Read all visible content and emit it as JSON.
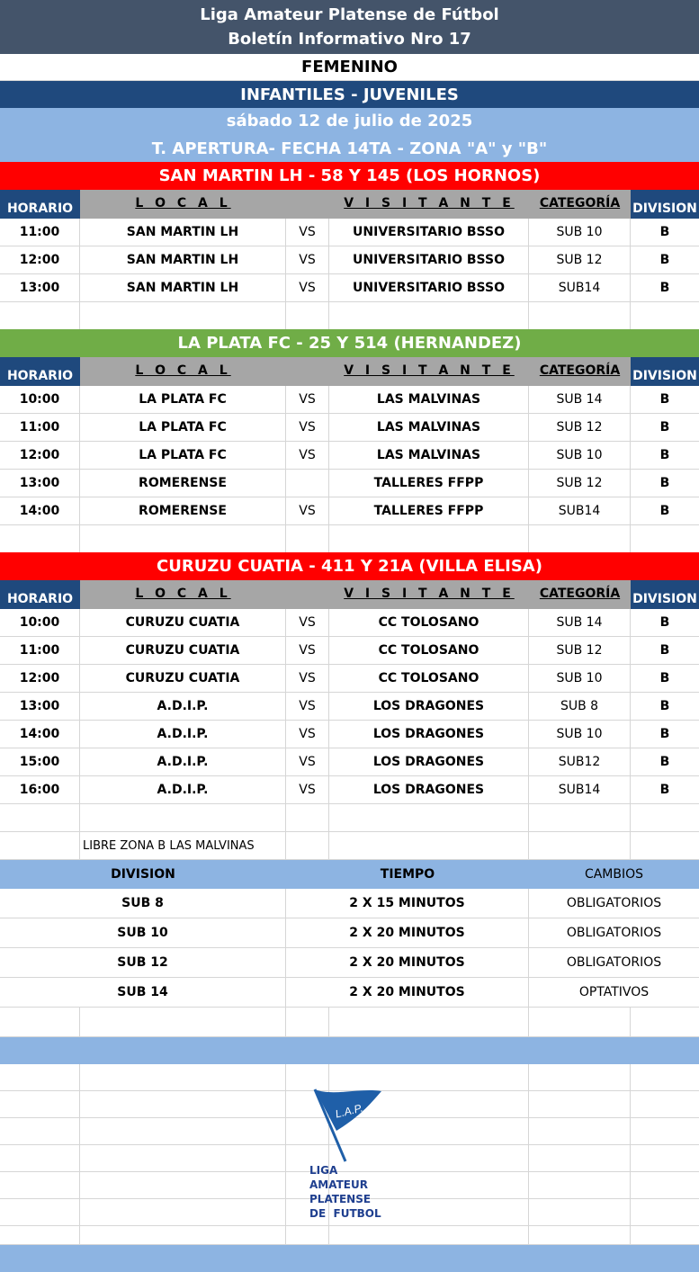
{
  "header": {
    "title_line1": "Liga Amateur Platense de Fútbol",
    "title_line2": "Boletín Informativo Nro 17",
    "branch": "FEMENINO",
    "categories": "INFANTILES - JUVENILES",
    "date": "sábado 12 de julio de 2025",
    "tournament": "T. APERTURA- FECHA 14TA - ZONA \"A\" y \"B\""
  },
  "columns": {
    "horario": "HORARIO",
    "local": "L O C A L",
    "visitante": "V I S I T A N T E",
    "categoria": "CATEGORÍA",
    "division": "DIVISION"
  },
  "venues": [
    {
      "name": "SAN MARTIN LH - 58 Y 145 (LOS HORNOS)",
      "color": "#ff0000",
      "matches": [
        {
          "time": "11:00",
          "local": "SAN MARTIN LH",
          "vs": "VS",
          "visitor": "UNIVERSITARIO BSSO",
          "category": "SUB 10",
          "division": "B"
        },
        {
          "time": "12:00",
          "local": "SAN MARTIN LH",
          "vs": "VS",
          "visitor": "UNIVERSITARIO BSSO",
          "category": "SUB 12",
          "division": "B"
        },
        {
          "time": "13:00",
          "local": "SAN MARTIN LH",
          "vs": "VS",
          "visitor": "UNIVERSITARIO BSSO",
          "category": "SUB14",
          "division": "B"
        }
      ]
    },
    {
      "name": "LA PLATA FC - 25 Y 514 (HERNANDEZ)",
      "color": "#70ad47",
      "matches": [
        {
          "time": "10:00",
          "local": "LA PLATA FC",
          "vs": "VS",
          "visitor": "LAS MALVINAS",
          "category": "SUB 14",
          "division": "B"
        },
        {
          "time": "11:00",
          "local": "LA PLATA FC",
          "vs": "VS",
          "visitor": "LAS MALVINAS",
          "category": "SUB 12",
          "division": "B"
        },
        {
          "time": "12:00",
          "local": "LA PLATA FC",
          "vs": "VS",
          "visitor": "LAS MALVINAS",
          "category": "SUB 10",
          "division": "B"
        },
        {
          "time": "13:00",
          "local": "ROMERENSE",
          "vs": "",
          "visitor": "TALLERES FFPP",
          "category": "SUB 12",
          "division": "B"
        },
        {
          "time": "14:00",
          "local": "ROMERENSE",
          "vs": "VS",
          "visitor": "TALLERES FFPP",
          "category": "SUB14",
          "division": "B"
        }
      ]
    },
    {
      "name": "CURUZU CUATIA - 411 Y 21A (VILLA ELISA)",
      "color": "#ff0000",
      "matches": [
        {
          "time": "10:00",
          "local": "CURUZU CUATIA",
          "vs": "VS",
          "visitor": "CC TOLOSANO",
          "category": "SUB 14",
          "division": "B"
        },
        {
          "time": "11:00",
          "local": "CURUZU CUATIA",
          "vs": "VS",
          "visitor": "CC TOLOSANO",
          "category": "SUB 12",
          "division": "B"
        },
        {
          "time": "12:00",
          "local": "CURUZU CUATIA",
          "vs": "VS",
          "visitor": "CC TOLOSANO",
          "category": "SUB 10",
          "division": "B"
        },
        {
          "time": "13:00",
          "local": "A.D.I.P.",
          "vs": "VS",
          "visitor": "LOS DRAGONES",
          "category": "SUB 8",
          "division": "B"
        },
        {
          "time": "14:00",
          "local": "A.D.I.P.",
          "vs": "VS",
          "visitor": "LOS DRAGONES",
          "category": "SUB 10",
          "division": "B"
        },
        {
          "time": "15:00",
          "local": "A.D.I.P.",
          "vs": "VS",
          "visitor": "LOS DRAGONES",
          "category": "SUB12",
          "division": "B"
        },
        {
          "time": "16:00",
          "local": "A.D.I.P.",
          "vs": "VS",
          "visitor": "LOS DRAGONES",
          "category": "SUB14",
          "division": "B"
        }
      ]
    }
  ],
  "libre_note": "LIBRE ZONA B LAS MALVINAS",
  "rules": {
    "headers": {
      "division": "DIVISION",
      "tiempo": "TIEMPO",
      "cambios": "CAMBIOS"
    },
    "rows": [
      {
        "division": "SUB 8",
        "tiempo": "2 X 15 MINUTOS",
        "cambios": "OBLIGATORIOS"
      },
      {
        "division": "SUB 10",
        "tiempo": "2 X 20 MINUTOS",
        "cambios": "OBLIGATORIOS"
      },
      {
        "division": "SUB 12",
        "tiempo": "2 X 20 MINUTOS",
        "cambios": "OBLIGATORIOS"
      },
      {
        "division": "SUB 14",
        "tiempo": "2 X 20 MINUTOS",
        "cambios": "OPTATIVOS"
      }
    ]
  },
  "logo": {
    "flag_text": "L.A.P.",
    "line1": "LIGA",
    "line2": "AMATEUR",
    "line3": "PLATENSE",
    "line4": "DE  FUTBOL",
    "color": "#1f5fa8"
  }
}
